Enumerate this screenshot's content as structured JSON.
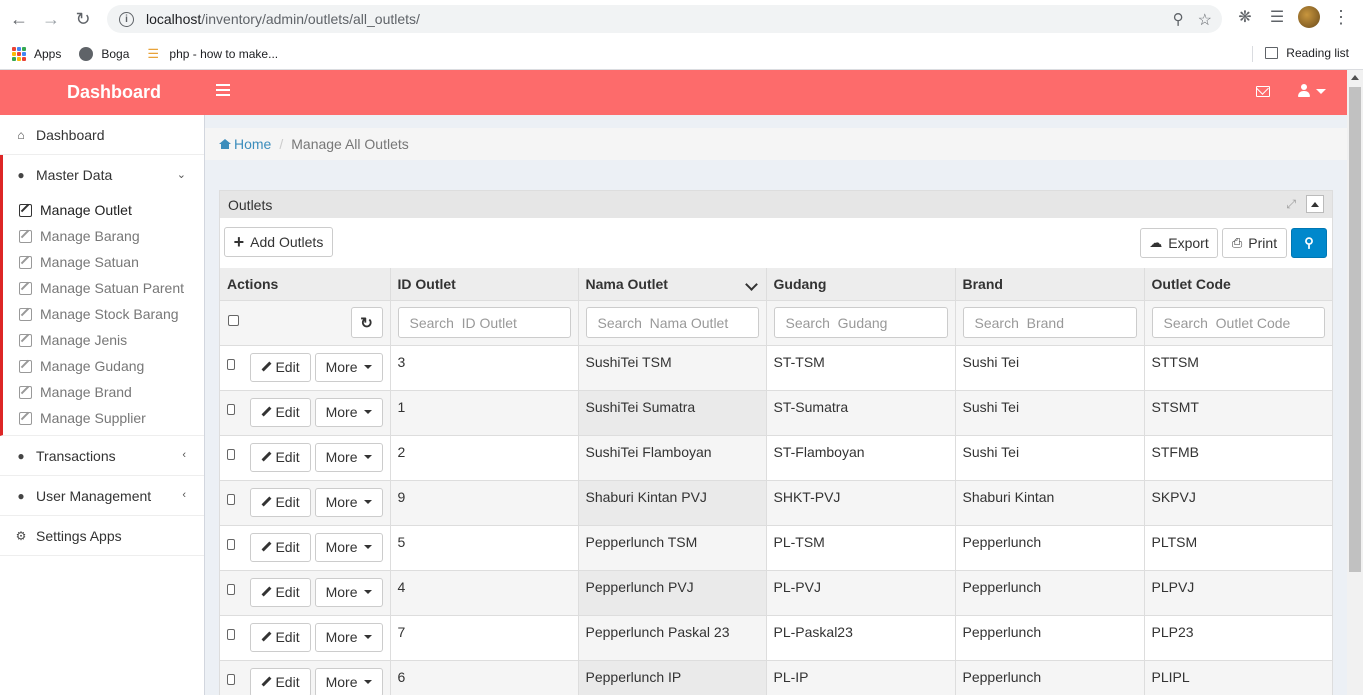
{
  "browser": {
    "url_host": "localhost",
    "url_path": "/inventory/admin/outlets/all_outlets/",
    "bookmarks": [
      "Apps",
      "Boga",
      "php - how to make..."
    ],
    "reading_list": "Reading list"
  },
  "header": {
    "brand": "Dashboard"
  },
  "sidebar": {
    "dashboard": "Dashboard",
    "master_data": "Master Data",
    "master_items": [
      "Manage Outlet",
      "Manage Barang",
      "Manage Satuan",
      "Manage Satuan Parent",
      "Manage Stock Barang",
      "Manage Jenis",
      "Manage Gudang",
      "Manage Brand",
      "Manage Supplier"
    ],
    "transactions": "Transactions",
    "user_management": "User Management",
    "settings": "Settings Apps"
  },
  "breadcrumb": {
    "home": "Home",
    "current": "Manage All Outlets"
  },
  "panel": {
    "title": "Outlets",
    "add_label": "Add Outlets",
    "export_label": "Export",
    "print_label": "Print"
  },
  "table": {
    "headers": [
      "Actions",
      "ID Outlet",
      "Nama Outlet",
      "Gudang",
      "Brand",
      "Outlet Code"
    ],
    "placeholders": [
      "Search  ID Outlet",
      "Search  Nama Outlet",
      "Search  Gudang",
      "Search  Brand",
      "Search  Outlet Code"
    ],
    "edit_label": "Edit",
    "more_label": "More",
    "rows": [
      [
        "3",
        "SushiTei TSM",
        "ST-TSM",
        "Sushi Tei",
        "STTSM"
      ],
      [
        "1",
        "SushiTei Sumatra",
        "ST-Sumatra",
        "Sushi Tei",
        "STSMT"
      ],
      [
        "2",
        "SushiTei Flamboyan",
        "ST-Flamboyan",
        "Sushi Tei",
        "STFMB"
      ],
      [
        "9",
        "Shaburi Kintan PVJ",
        "SHKT-PVJ",
        "Shaburi Kintan",
        "SKPVJ"
      ],
      [
        "5",
        "Pepperlunch TSM",
        "PL-TSM",
        "Pepperlunch",
        "PLTSM"
      ],
      [
        "4",
        "Pepperlunch PVJ",
        "PL-PVJ",
        "Pepperlunch",
        "PLPVJ"
      ],
      [
        "7",
        "Pepperlunch Paskal 23",
        "PL-Paskal23",
        "Pepperlunch",
        "PLP23"
      ],
      [
        "6",
        "Pepperlunch IP",
        "PL-IP",
        "Pepperlunch",
        "PLIPL"
      ]
    ]
  },
  "colors": {
    "header_bg": "#fd6b6b",
    "active_border": "#dd2626",
    "link": "#3c8dbc",
    "primary_button": "#0088cc"
  }
}
